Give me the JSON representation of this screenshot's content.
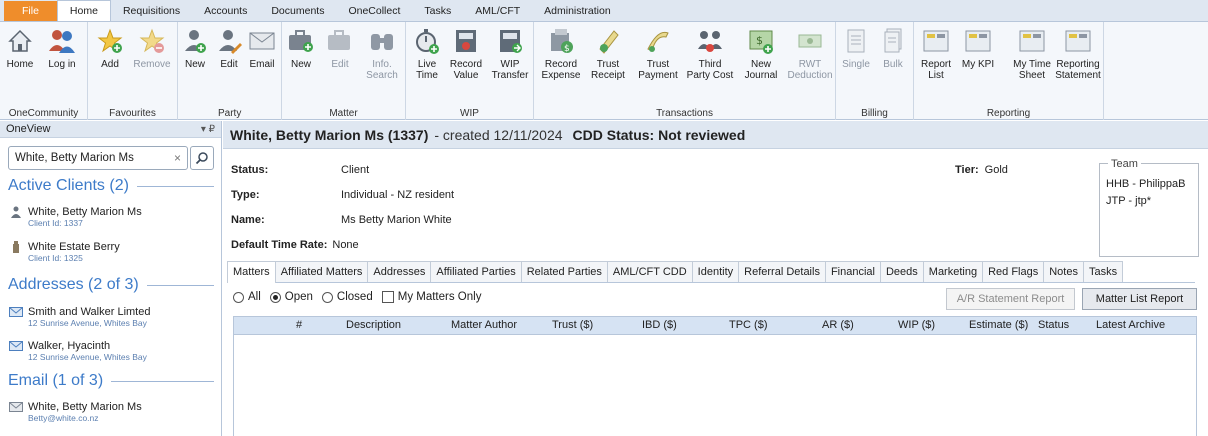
{
  "menu": [
    "File",
    "Home",
    "Requisitions",
    "Accounts",
    "Documents",
    "OneCollect",
    "Tasks",
    "AML/CFT",
    "Administration"
  ],
  "ribbon": {
    "groups": [
      {
        "label": "OneCommunity",
        "buttons": [
          "Home",
          "Log in"
        ]
      },
      {
        "label": "Favourites",
        "buttons": [
          "Add",
          "Remove"
        ]
      },
      {
        "label": "Party",
        "buttons": [
          "New",
          "Edit",
          "Email"
        ]
      },
      {
        "label": "Matter",
        "buttons": [
          "New",
          "Edit",
          "Info.\nSearch"
        ]
      },
      {
        "label": "WIP",
        "buttons": [
          "Live\nTime",
          "Record\nValue",
          "WIP\nTransfer"
        ]
      },
      {
        "label": "Transactions",
        "buttons": [
          "Record\nExpense",
          "Trust\nReceipt",
          "Trust\nPayment",
          "Third\nParty Cost",
          "New\nJournal",
          "RWT\nDeduction"
        ]
      },
      {
        "label": "Billing",
        "buttons": [
          "Single",
          "Bulk"
        ]
      },
      {
        "label": "Reporting",
        "buttons": [
          "Report\nList",
          "My KPI",
          "My Time\nSheet",
          "Reporting\nStatement"
        ]
      }
    ]
  },
  "left": {
    "title": "OneView",
    "pin": "▾ ₽",
    "search_value": "White, Betty Marion Ms",
    "sections": [
      {
        "title": "Active Clients (2)",
        "items": [
          {
            "name": "White, Betty Marion Ms",
            "sub": "Client Id: 1337"
          },
          {
            "name": "White Estate Berry",
            "sub": "Client Id: 1325"
          }
        ]
      },
      {
        "title": "Addresses (2 of 3)",
        "items": [
          {
            "name": "Smith and Walker Limted",
            "sub": "12 Sunrise Avenue, Whites Bay"
          },
          {
            "name": "Walker, Hyacinth",
            "sub": "12 Sunrise Avenue, Whites Bay"
          }
        ]
      },
      {
        "title": "Email (1 of 3)",
        "items": [
          {
            "name": "White, Betty Marion Ms",
            "sub": "Betty@white.co.nz"
          }
        ]
      }
    ]
  },
  "header": {
    "name": "White, Betty Marion Ms (1337)",
    "created": "- created 12/11/2024",
    "cdd": "CDD Status: Not reviewed"
  },
  "details": {
    "status_label": "Status:",
    "status": "Client",
    "type_label": "Type:",
    "type": "Individual - NZ resident",
    "name_label": "Name:",
    "name": "Ms Betty Marion White",
    "rate_label": "Default Time Rate:",
    "rate": "None",
    "tier_label": "Tier:",
    "tier": "Gold",
    "team_label": "Team",
    "team": [
      "HHB - PhilippaB",
      "JTP - jtp*"
    ]
  },
  "tabs": [
    "Matters",
    "Affiliated Matters",
    "Addresses",
    "Affiliated Parties",
    "Related Parties",
    "AML/CFT CDD",
    "Identity",
    "Referral Details",
    "Financial",
    "Deeds",
    "Marketing",
    "Red Flags",
    "Notes",
    "Tasks"
  ],
  "filters": {
    "all": "All",
    "open": "Open",
    "closed": "Closed",
    "mine": "My Matters Only"
  },
  "buttons": {
    "ar": "A/R Statement Report",
    "matter_list": "Matter List Report"
  },
  "columns": [
    "#",
    "Description",
    "Matter Author",
    "Trust ($)",
    "IBD ($)",
    "TPC ($)",
    "AR ($)",
    "WIP ($)",
    "Estimate ($)",
    "Status",
    "Latest Archive"
  ],
  "colors": {
    "accent": "#3d7bc9",
    "file": "#ef8d2b",
    "ribbon_bg": "#f4f7fb",
    "header_bg": "#dfe7f1"
  }
}
